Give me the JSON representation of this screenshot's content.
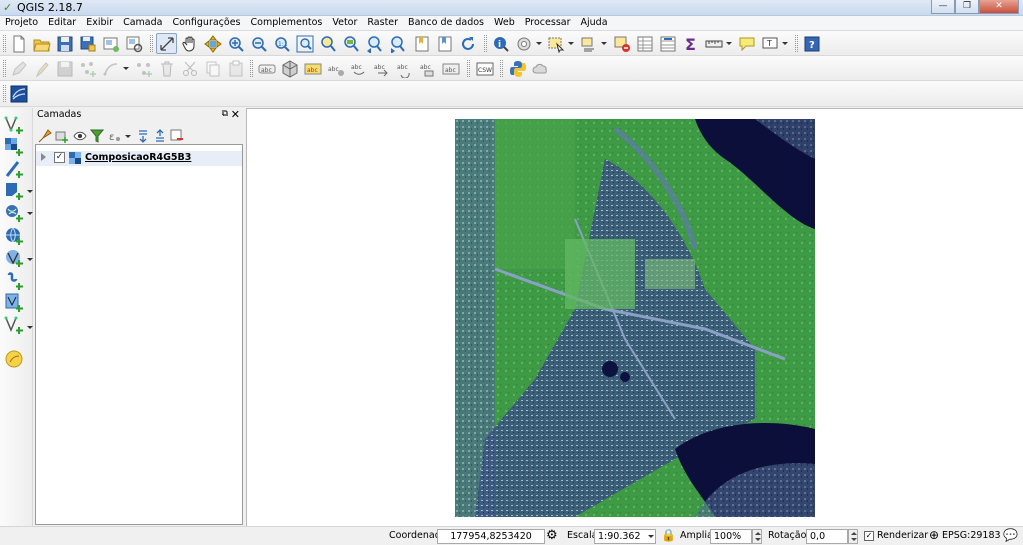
{
  "window": {
    "title": "QGIS 2.18.7"
  },
  "menu": [
    "Projeto",
    "Editar",
    "Exibir",
    "Camada",
    "Configurações",
    "Complementos",
    "Vetor",
    "Raster",
    "Banco de dados",
    "Web",
    "Processar",
    "Ajuda"
  ],
  "toolbar_icons": {
    "row1": [
      "new-project-icon",
      "open-project-icon",
      "save-project-icon",
      "save-as-icon",
      "new-print-composer-icon",
      "composer-manager-icon",
      "touch-zoom-icon",
      "pan-icon",
      "pan-to-selection-icon",
      "zoom-in-icon",
      "zoom-out-icon",
      "zoom-actual-icon",
      "zoom-full-icon",
      "zoom-to-selection-icon",
      "zoom-to-layer-icon",
      "zoom-last-icon",
      "zoom-next-icon",
      "new-bookmark-icon",
      "show-bookmarks-icon",
      "refresh-icon",
      "identify-icon",
      "run-feature-action-icon",
      "select-features-icon",
      "select-by-value-icon",
      "deselect-icon",
      "attribute-table-icon",
      "field-calculator-icon",
      "statistics-sigma-icon",
      "measure-icon",
      "map-tips-icon",
      "text-annotation-icon",
      "help-icon"
    ],
    "row2": [
      "current-edits-icon",
      "toggle-editing-icon",
      "save-edits-icon",
      "add-feature-icon",
      "move-feature-icon",
      "node-tool-icon",
      "delete-selected-icon",
      "cut-features-icon",
      "copy-features-icon",
      "paste-features-icon",
      "label-toolbar-icon",
      "layer-labeling-icon",
      "label-highlight-icon",
      "pin-labels-icon",
      "show-hide-labels-icon",
      "move-label-icon",
      "rotate-label-icon",
      "change-label-icon",
      "csw-icon",
      "python-console-icon",
      "cloud-icon"
    ],
    "row3": [
      "georeferencer-icon"
    ]
  },
  "left_toolbar_icons": [
    "add-vector-layer-icon",
    "add-raster-layer-icon",
    "add-delimited-text-icon",
    "add-spatialite-layer-icon",
    "add-postgis-layer-icon",
    "add-wms-layer-icon",
    "add-wfs-layer-icon",
    "add-oracle-layer-icon",
    "add-mssql-layer-icon",
    "new-shapefile-layer-icon",
    "gps-tools-icon"
  ],
  "layers_panel": {
    "title": "Camadas",
    "tool_icons": [
      "open-styling-icon",
      "add-group-icon",
      "manage-visibility-icon",
      "filter-legend-icon",
      "filter-expression-icon",
      "expand-all-icon",
      "collapse-all-icon",
      "remove-layer-icon"
    ],
    "layers": [
      {
        "name": "ComposicaoR4G5B3",
        "checked": true
      }
    ]
  },
  "status": {
    "coordinate_label": "Coordenada",
    "coordinate_value": "177954,8253420",
    "scale_label": "Escala",
    "scale_value": "1:90.362",
    "magnifier_label": "Ampliar",
    "magnifier_value": "100%",
    "rotation_label": "Rotação",
    "rotation_value": "0,0",
    "render_label": "Renderizar",
    "render_checked": true,
    "crs": "EPSG:29183"
  },
  "colors": {
    "water": "#0b0f3a",
    "vegetation": "#3a9c3f",
    "urban": "#5a6f9c",
    "accent": "#1f66c9"
  }
}
